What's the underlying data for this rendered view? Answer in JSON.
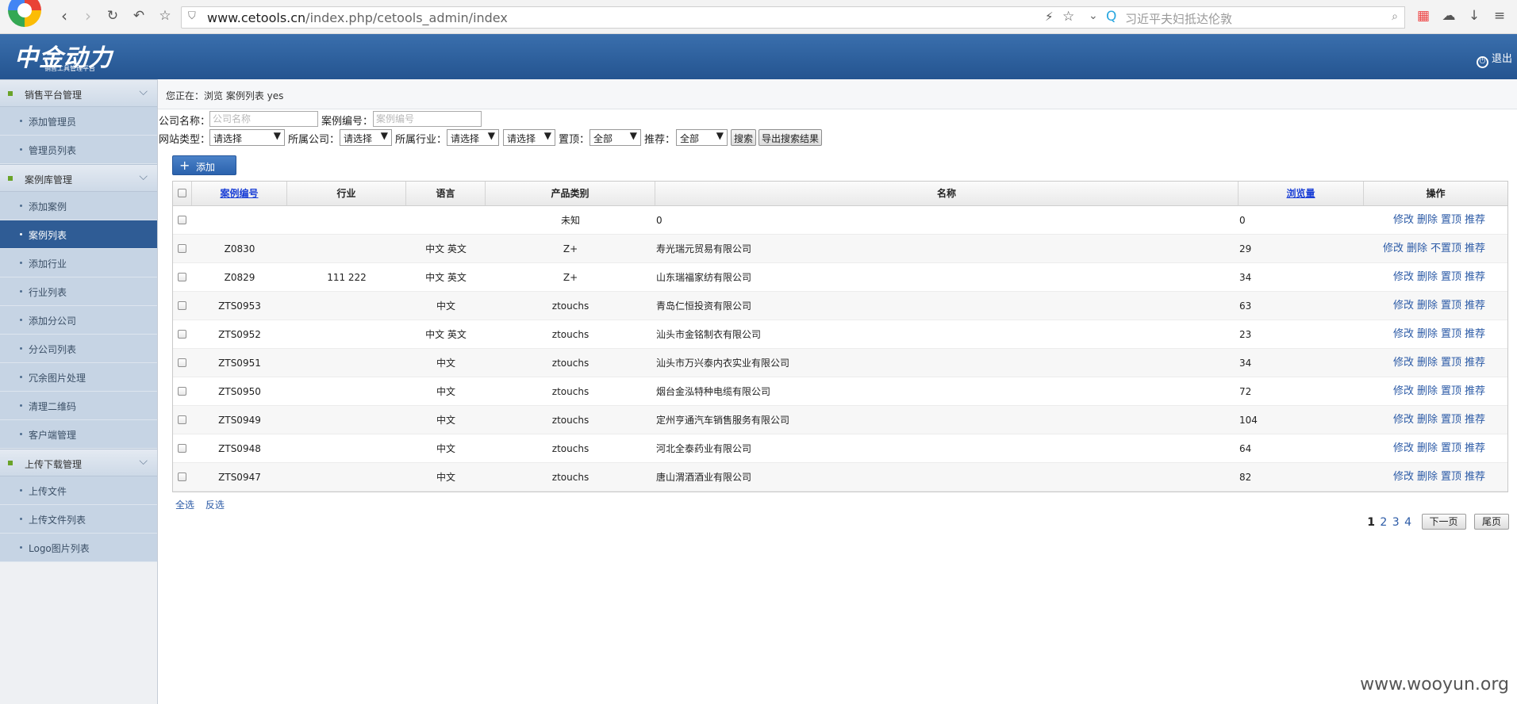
{
  "browser": {
    "url_domain": "www.cetools.cn",
    "url_path": "/index.php/cetools_admin/index",
    "search_placeholder": "习近平夫妇抵达伦敦"
  },
  "header": {
    "brand": "中金动力",
    "brand_sub": "销售工具管理平台",
    "logout": "退出"
  },
  "sidebar": {
    "groups": [
      {
        "label": "销售平台管理",
        "items": [
          "添加管理员",
          "管理员列表"
        ]
      },
      {
        "label": "案例库管理",
        "items": [
          "添加案例",
          "案例列表",
          "添加行业",
          "行业列表",
          "添加分公司",
          "分公司列表",
          "冗余图片处理",
          "清理二维码",
          "客户端管理"
        ]
      },
      {
        "label": "上传下载管理",
        "items": [
          "上传文件",
          "上传文件列表",
          "Logo图片列表"
        ]
      }
    ],
    "active": "案例列表"
  },
  "breadcrumb": "您正在：浏览 案例列表 yes",
  "filters": {
    "company_label": "公司名称：",
    "company_placeholder": "公司名称",
    "case_no_label": "案例编号：",
    "case_no_placeholder": "案例编号",
    "site_type_label": "网站类型：",
    "site_type_value": "请选择",
    "branch_label": "所属公司：",
    "branch_value": "请选择",
    "industry_label": "所属行业：",
    "industry_value": "请选择",
    "industry2_value": "请选择",
    "top_label": "置顶：",
    "top_value": "全部",
    "recommend_label": "推荐：",
    "recommend_value": "全部",
    "search_btn": "搜索",
    "export_btn": "导出搜索结果"
  },
  "add_button": "添加",
  "table": {
    "headers": [
      "案例编号",
      "行业",
      "语言",
      "产品类别",
      "名称",
      "浏览量",
      "操作"
    ],
    "rows": [
      {
        "no": "",
        "industry": "",
        "lang": "",
        "cat": "未知",
        "name": "0",
        "views": "0",
        "ops": [
          "修改",
          "删除",
          "置顶",
          "推荐"
        ]
      },
      {
        "no": "Z0830",
        "industry": "",
        "lang": "中文 英文",
        "cat": "Z+",
        "name": "寿光瑞元贸易有限公司",
        "views": "29",
        "ops": [
          "修改",
          "删除",
          "不置顶",
          "推荐"
        ]
      },
      {
        "no": "Z0829",
        "industry": "111 222",
        "lang": "中文 英文",
        "cat": "Z+",
        "name": "山东瑞福家纺有限公司",
        "views": "34",
        "ops": [
          "修改",
          "删除",
          "置顶",
          "推荐"
        ]
      },
      {
        "no": "ZTS0953",
        "industry": "",
        "lang": "中文",
        "cat": "ztouchs",
        "name": "青岛仁恒投资有限公司",
        "views": "63",
        "ops": [
          "修改",
          "删除",
          "置顶",
          "推荐"
        ]
      },
      {
        "no": "ZTS0952",
        "industry": "",
        "lang": "中文 英文",
        "cat": "ztouchs",
        "name": "汕头市金铭制衣有限公司",
        "views": "23",
        "ops": [
          "修改",
          "删除",
          "置顶",
          "推荐"
        ]
      },
      {
        "no": "ZTS0951",
        "industry": "",
        "lang": "中文",
        "cat": "ztouchs",
        "name": "汕头市万兴泰内衣实业有限公司",
        "views": "34",
        "ops": [
          "修改",
          "删除",
          "置顶",
          "推荐"
        ]
      },
      {
        "no": "ZTS0950",
        "industry": "",
        "lang": "中文",
        "cat": "ztouchs",
        "name": "烟台金泓特种电缆有限公司",
        "views": "72",
        "ops": [
          "修改",
          "删除",
          "置顶",
          "推荐"
        ]
      },
      {
        "no": "ZTS0949",
        "industry": "",
        "lang": "中文",
        "cat": "ztouchs",
        "name": "定州亨通汽车销售服务有限公司",
        "views": "104",
        "ops": [
          "修改",
          "删除",
          "置顶",
          "推荐"
        ]
      },
      {
        "no": "ZTS0948",
        "industry": "",
        "lang": "中文",
        "cat": "ztouchs",
        "name": "河北全泰药业有限公司",
        "views": "64",
        "ops": [
          "修改",
          "删除",
          "置顶",
          "推荐"
        ]
      },
      {
        "no": "ZTS0947",
        "industry": "",
        "lang": "中文",
        "cat": "ztouchs",
        "name": "唐山渭酒酒业有限公司",
        "views": "82",
        "ops": [
          "修改",
          "删除",
          "置顶",
          "推荐"
        ]
      }
    ]
  },
  "bulk": {
    "select_all": "全选",
    "invert": "反选"
  },
  "pager": {
    "pages": [
      "1",
      "2",
      "3",
      "4"
    ],
    "current": "1",
    "next": "下一页",
    "last": "尾页"
  },
  "watermark": "www.wooyun.org"
}
